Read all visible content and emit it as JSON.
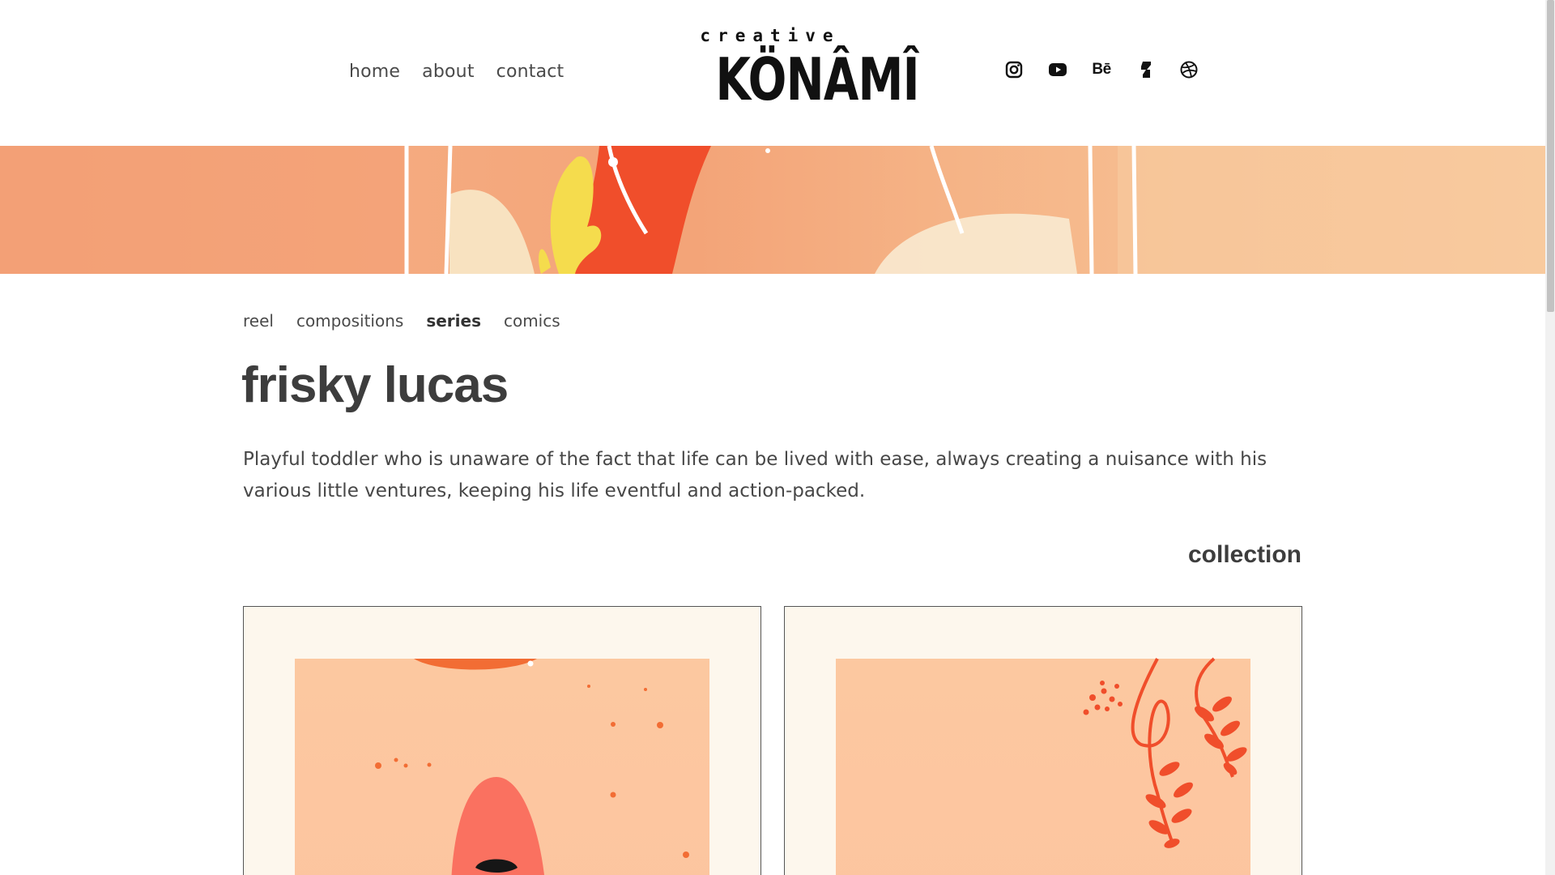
{
  "nav": {
    "home": "home",
    "about": "about",
    "contact": "contact"
  },
  "logo": {
    "top": "creative",
    "main": "KÖNÂMÎ"
  },
  "social": {
    "icons": [
      "instagram-icon",
      "youtube-icon",
      "behance-icon",
      "deviantart-icon",
      "dribbble-icon"
    ],
    "behance_label": "Bē"
  },
  "subnav": {
    "reel": "reel",
    "compositions": "compositions",
    "series": "series",
    "comics": "comics",
    "active": "series"
  },
  "page": {
    "title": "frisky lucas",
    "description": "Playful toddler who is unaware of the fact that life can be lived with ease, always creating a nuisance with his various little ventures, keeping his life eventful and action-packed.",
    "collection_heading": "collection"
  },
  "colors": {
    "accent_orange": "#f04e2b",
    "peach": "#fcc8a0",
    "cream": "#fdf7ed",
    "text": "#3d3d3d"
  }
}
